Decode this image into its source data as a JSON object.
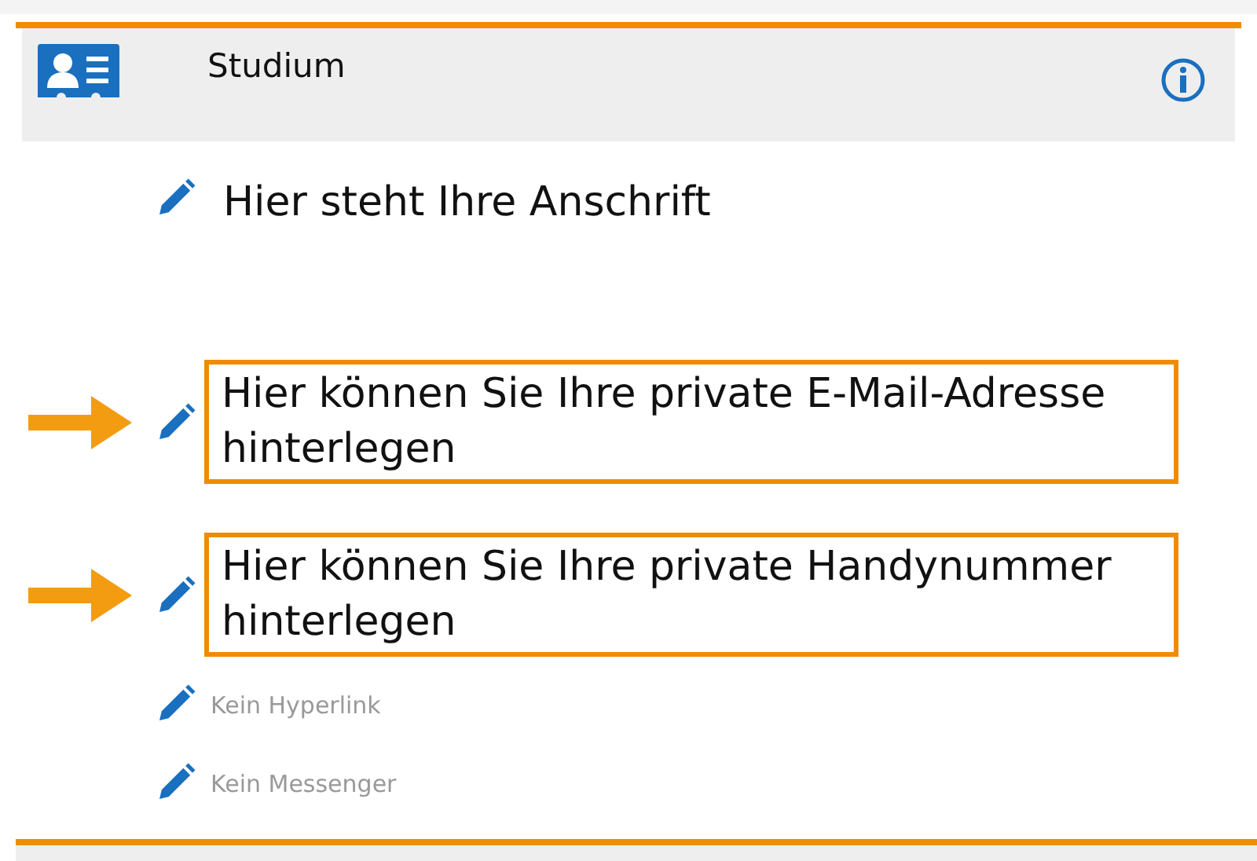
{
  "section": {
    "title": "Studium"
  },
  "entries": [
    {
      "kind": "value",
      "text": "Hier steht Ihre Anschrift",
      "highlighted": false
    },
    {
      "kind": "value",
      "text": "Hier können Sie Ihre private E-Mail-Adresse hinterlegen",
      "highlighted": true
    },
    {
      "kind": "value",
      "text": "Hier können Sie Ihre private Handynummer hinterlegen",
      "highlighted": true
    },
    {
      "kind": "empty",
      "text": "Kein Hyperlink",
      "highlighted": false
    },
    {
      "kind": "empty",
      "text": "Kein Messenger",
      "highlighted": false
    }
  ]
}
